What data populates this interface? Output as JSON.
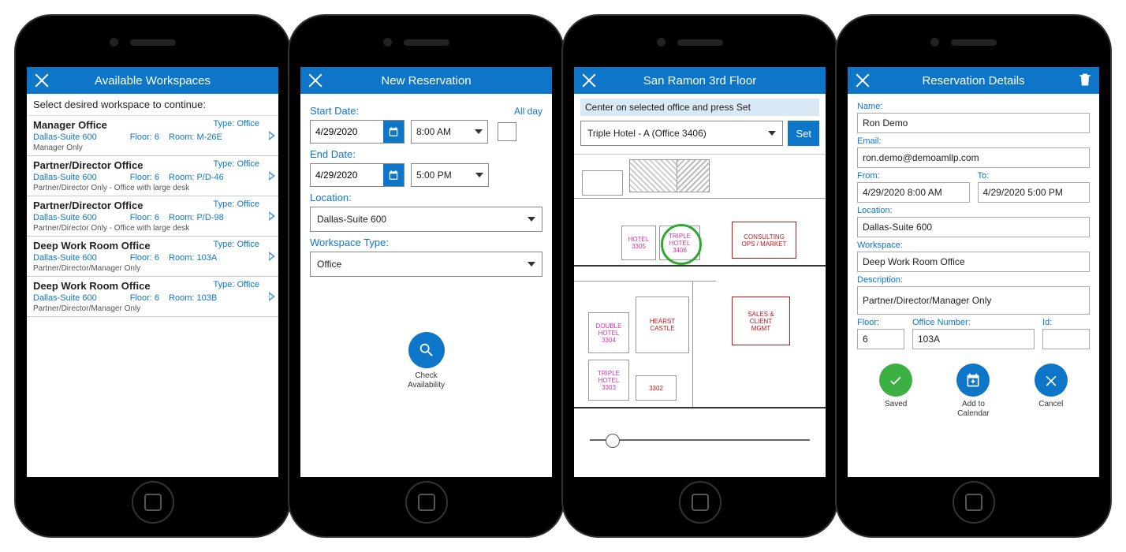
{
  "screen1": {
    "title": "Available Workspaces",
    "subtitle": "Select desired workspace to continue:",
    "items": [
      {
        "title": "Manager Office",
        "type": "Type: Office",
        "loc": "Dallas-Suite 600",
        "floor": "Floor: 6",
        "room": "Room: M-26E",
        "note": "Manager Only"
      },
      {
        "title": "Partner/Director Office",
        "type": "Type: Office",
        "loc": "Dallas-Suite 600",
        "floor": "Floor: 6",
        "room": "Room: P/D-46",
        "note": "Partner/Director Only - Office with large desk"
      },
      {
        "title": "Partner/Director Office",
        "type": "Type: Office",
        "loc": "Dallas-Suite 600",
        "floor": "Floor: 6",
        "room": "Room: P/D-98",
        "note": "Partner/Director Only - Office with large desk"
      },
      {
        "title": "Deep Work Room Office",
        "type": "Type: Office",
        "loc": "Dallas-Suite 600",
        "floor": "Floor: 6",
        "room": "Room: 103A",
        "note": "Partner/Director/Manager Only"
      },
      {
        "title": "Deep Work Room Office",
        "type": "Type: Office",
        "loc": "Dallas-Suite 600",
        "floor": "Floor: 6",
        "room": "Room: 103B",
        "note": "Partner/Director/Manager Only"
      }
    ]
  },
  "screen2": {
    "title": "New Reservation",
    "start_label": "Start Date:",
    "end_label": "End Date:",
    "allday": "All day",
    "start_date": "4/29/2020",
    "start_time": "8:00 AM",
    "end_date": "4/29/2020",
    "end_time": "5:00 PM",
    "loc_label": "Location:",
    "loc_value": "Dallas-Suite 600",
    "type_label": "Workspace Type:",
    "type_value": "Office",
    "check_label": "Check\nAvailability"
  },
  "screen3": {
    "title": "San Ramon 3rd Floor",
    "hint": "Center on selected office and press Set",
    "office": "Triple Hotel - A (Office 3406)",
    "set": "Set",
    "rooms": {
      "hotel": "HOTEL\n3305",
      "triple": "TRIPLE\nHOTEL\n3406",
      "consult": "CONSULTING\nOPS / MARKET",
      "double": "DOUBLE\nHOTEL\n3304",
      "hearst": "HEARST\nCASTLE",
      "sales": "SALES &\nCLIENT\nMGMT",
      "triple2": "TRIPLE\nHOTEL\n3303",
      "r3302": "3302"
    }
  },
  "screen4": {
    "title": "Reservation Details",
    "name_l": "Name:",
    "name": "Ron Demo",
    "email_l": "Email:",
    "email": "ron.demo@demoamllp.com",
    "from_l": "From:",
    "from": "4/29/2020 8:00 AM",
    "to_l": "To:",
    "to": "4/29/2020 5:00 PM",
    "loc_l": "Location:",
    "loc": "Dallas-Suite 600",
    "ws_l": "Workspace:",
    "ws": "Deep Work Room Office",
    "desc_l": "Description:",
    "desc": "Partner/Director/Manager Only",
    "floor_l": "Floor:",
    "floor": "6",
    "off_l": "Office Number:",
    "off": "103A",
    "id_l": "Id:",
    "id": "",
    "saved": "Saved",
    "addcal": "Add to\nCalendar",
    "cancel": "Cancel"
  }
}
